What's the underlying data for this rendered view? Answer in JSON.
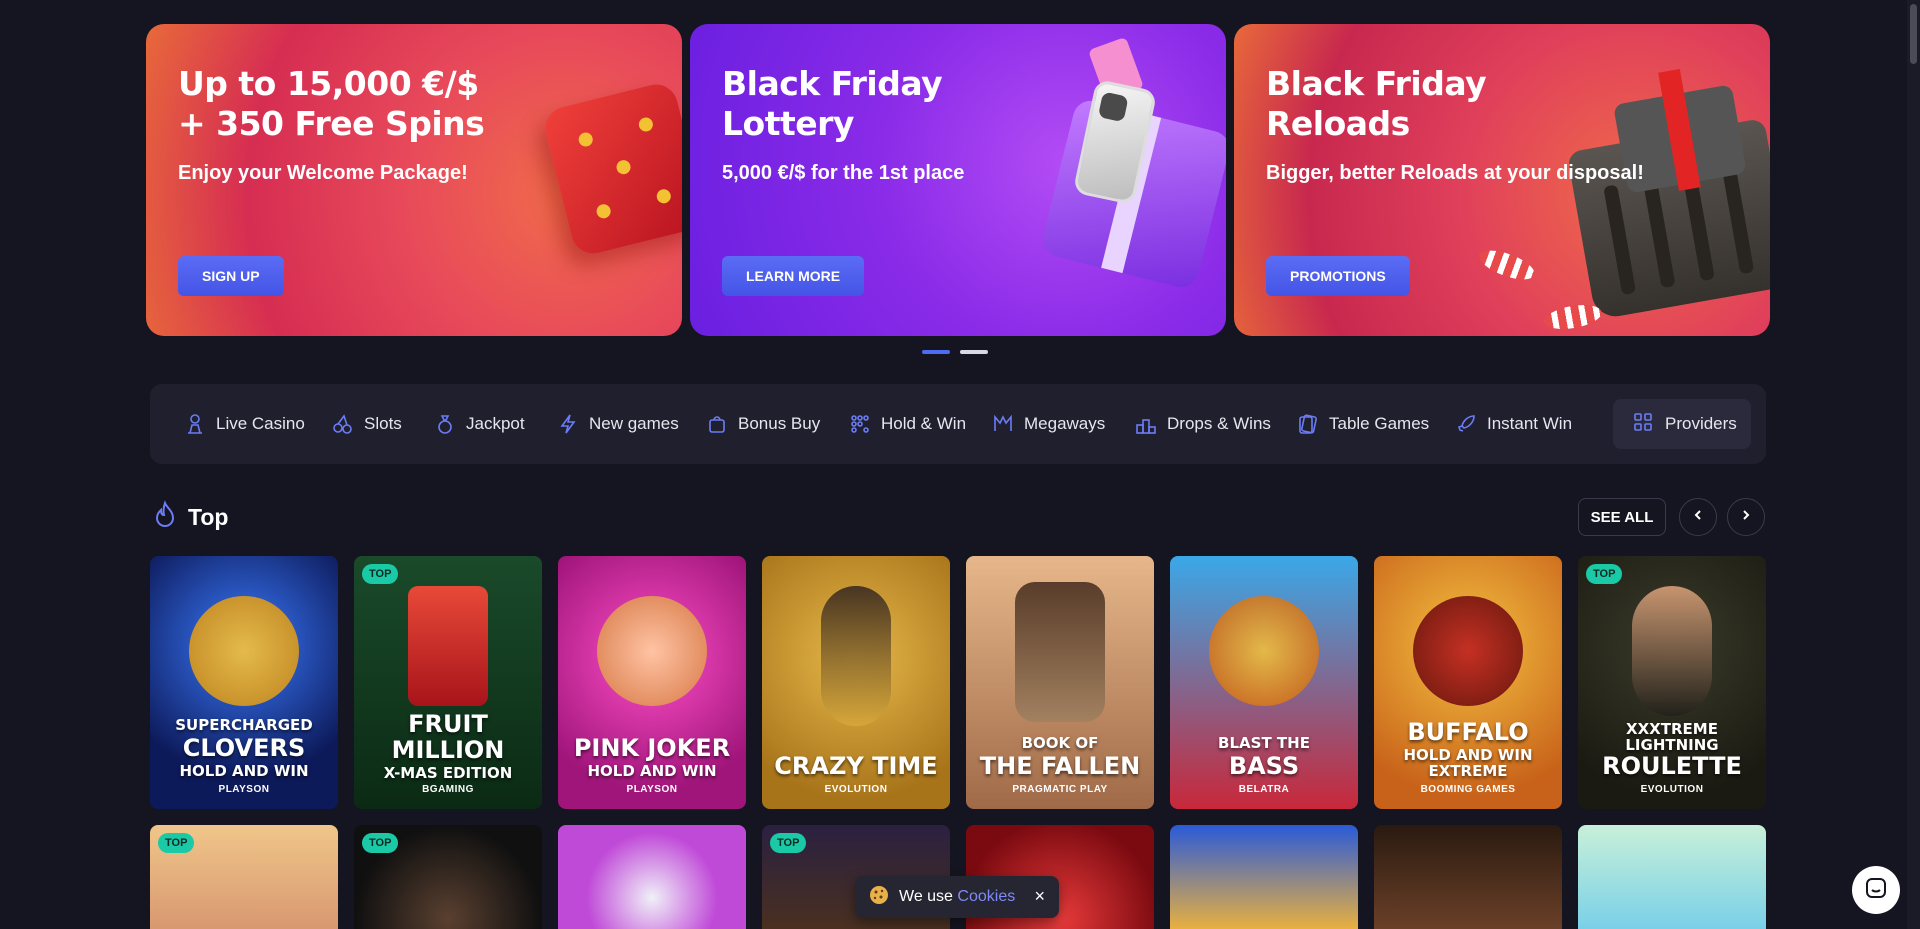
{
  "banners": [
    {
      "title": "Up to 15,000 €/$\n+ 350 Free Spins",
      "subtitle": "Enjoy your Welcome Package!",
      "button": "SIGN UP"
    },
    {
      "title": "Black Friday\nLottery",
      "subtitle": "5,000 €/$ for the 1st place",
      "button": "LEARN MORE"
    },
    {
      "title": "Black Friday\nReloads",
      "subtitle": "Bigger, better Reloads at your disposal!",
      "button": "PROMOTIONS"
    }
  ],
  "categories": [
    {
      "label": "Live Casino",
      "icon": "dealer-icon"
    },
    {
      "label": "Slots",
      "icon": "cherries-icon"
    },
    {
      "label": "Jackpot",
      "icon": "money-bag-icon"
    },
    {
      "label": "New games",
      "icon": "lightning-icon"
    },
    {
      "label": "Bonus Buy",
      "icon": "gift-bag-icon"
    },
    {
      "label": "Hold & Win",
      "icon": "dots-grid-icon"
    },
    {
      "label": "Megaways",
      "icon": "megaways-icon"
    },
    {
      "label": "Drops & Wins",
      "icon": "podium-icon"
    },
    {
      "label": "Table Games",
      "icon": "cards-icon"
    },
    {
      "label": "Instant Win",
      "icon": "rocket-icon"
    }
  ],
  "providers_label": "Providers",
  "section": {
    "title": "Top",
    "see_all": "SEE ALL"
  },
  "games_row1": [
    {
      "title_lines": [
        "SUPERCHARGED",
        "CLOVERS",
        "HOLD AND WIN"
      ],
      "provider": "PLAYSON",
      "badge": ""
    },
    {
      "title_lines": [
        "FRUIT",
        "MILLION",
        "X-MAS EDITION"
      ],
      "provider": "BGAMING",
      "badge": "TOP"
    },
    {
      "title_lines": [
        "PINK JOKER",
        "HOLD AND WIN"
      ],
      "provider": "PLAYSON",
      "badge": ""
    },
    {
      "title_lines": [
        "CRAZY TIME"
      ],
      "provider": "EVOLUTION",
      "badge": ""
    },
    {
      "title_lines": [
        "BOOK OF",
        "THE FALLEN"
      ],
      "provider": "PRAGMATIC PLAY",
      "badge": ""
    },
    {
      "title_lines": [
        "BLAST THE",
        "BASS"
      ],
      "provider": "BELATRA",
      "badge": ""
    },
    {
      "title_lines": [
        "BUFFALO",
        "HOLD AND WIN",
        "EXTREME"
      ],
      "provider": "BOOMING GAMES",
      "badge": ""
    },
    {
      "title_lines": [
        "XXXTREME",
        "LIGHTNING",
        "ROULETTE"
      ],
      "provider": "EVOLUTION",
      "badge": "TOP"
    }
  ],
  "games_row2_badges": [
    "TOP",
    "TOP",
    "",
    "TOP",
    "",
    "",
    "",
    ""
  ],
  "cookie": {
    "text": "We use",
    "link": "Cookies",
    "close": "×"
  }
}
